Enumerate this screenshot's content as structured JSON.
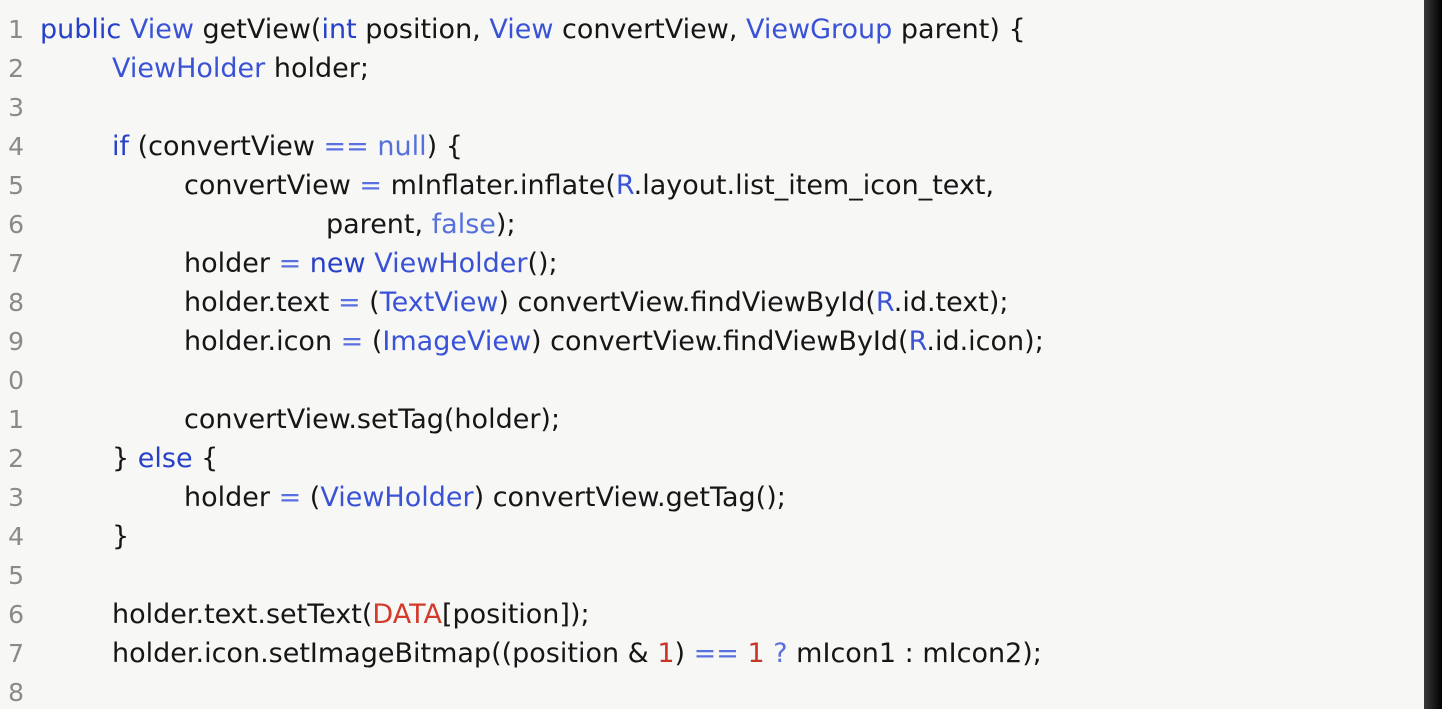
{
  "editor": {
    "lines": [
      {
        "n": "1",
        "indent": 0,
        "tokens": [
          [
            "kw",
            "public"
          ],
          [
            "plain",
            " "
          ],
          [
            "ty",
            "View"
          ],
          [
            "plain",
            " getView("
          ],
          [
            "kw",
            "int"
          ],
          [
            "plain",
            " position, "
          ],
          [
            "ty",
            "View"
          ],
          [
            "plain",
            " convertView, "
          ],
          [
            "ty",
            "ViewGroup"
          ],
          [
            "plain",
            " parent) {"
          ]
        ]
      },
      {
        "n": "2",
        "indent": 1,
        "tokens": [
          [
            "ty",
            "ViewHolder"
          ],
          [
            "plain",
            " holder;"
          ]
        ]
      },
      {
        "n": "3",
        "indent": 0,
        "tokens": []
      },
      {
        "n": "4",
        "indent": 1,
        "tokens": [
          [
            "kw",
            "if"
          ],
          [
            "plain",
            " (convertView "
          ],
          [
            "op",
            "=="
          ],
          [
            "plain",
            " "
          ],
          [
            "lit",
            "null"
          ],
          [
            "plain",
            ") {"
          ]
        ]
      },
      {
        "n": "5",
        "indent": 2,
        "tokens": [
          [
            "plain",
            "convertView "
          ],
          [
            "op",
            "="
          ],
          [
            "plain",
            " mInflater.inflate("
          ],
          [
            "ty",
            "R"
          ],
          [
            "plain",
            ".layout.list_item_icon_text,"
          ]
        ]
      },
      {
        "n": "6",
        "indent": 4,
        "tokens": [
          [
            "plain",
            "parent, "
          ],
          [
            "lit",
            "false"
          ],
          [
            "plain",
            ");"
          ]
        ]
      },
      {
        "n": "7",
        "indent": 2,
        "tokens": [
          [
            "plain",
            "holder "
          ],
          [
            "op",
            "="
          ],
          [
            "plain",
            " "
          ],
          [
            "kw",
            "new"
          ],
          [
            "plain",
            " "
          ],
          [
            "ty",
            "ViewHolder"
          ],
          [
            "plain",
            "();"
          ]
        ]
      },
      {
        "n": "8",
        "indent": 2,
        "tokens": [
          [
            "plain",
            "holder.text "
          ],
          [
            "op",
            "="
          ],
          [
            "plain",
            " ("
          ],
          [
            "ty",
            "TextView"
          ],
          [
            "plain",
            ") convertView.findViewById("
          ],
          [
            "ty",
            "R"
          ],
          [
            "plain",
            ".id.text);"
          ]
        ]
      },
      {
        "n": "9",
        "indent": 2,
        "tokens": [
          [
            "plain",
            "holder.icon "
          ],
          [
            "op",
            "="
          ],
          [
            "plain",
            " ("
          ],
          [
            "ty",
            "ImageView"
          ],
          [
            "plain",
            ") convertView.findViewById("
          ],
          [
            "ty",
            "R"
          ],
          [
            "plain",
            ".id.icon);"
          ]
        ]
      },
      {
        "n": "0",
        "indent": 0,
        "tokens": []
      },
      {
        "n": "1",
        "indent": 2,
        "tokens": [
          [
            "plain",
            "convertView.setTag(holder);"
          ]
        ]
      },
      {
        "n": "2",
        "indent": 1,
        "tokens": [
          [
            "plain",
            "} "
          ],
          [
            "kw",
            "else"
          ],
          [
            "plain",
            " {"
          ]
        ]
      },
      {
        "n": "3",
        "indent": 2,
        "tokens": [
          [
            "plain",
            "holder "
          ],
          [
            "op",
            "="
          ],
          [
            "plain",
            " ("
          ],
          [
            "ty",
            "ViewHolder"
          ],
          [
            "plain",
            ") convertView.getTag();"
          ]
        ]
      },
      {
        "n": "4",
        "indent": 1,
        "tokens": [
          [
            "plain",
            "}"
          ]
        ]
      },
      {
        "n": "5",
        "indent": 0,
        "tokens": []
      },
      {
        "n": "6",
        "indent": 1,
        "tokens": [
          [
            "plain",
            "holder.text.setText("
          ],
          [
            "red",
            "DATA"
          ],
          [
            "plain",
            "[position]);"
          ]
        ]
      },
      {
        "n": "7",
        "indent": 1,
        "tokens": [
          [
            "plain",
            "holder.icon.setImageBitmap((position & "
          ],
          [
            "num",
            "1"
          ],
          [
            "plain",
            ") "
          ],
          [
            "op",
            "=="
          ],
          [
            "plain",
            " "
          ],
          [
            "num",
            "1"
          ],
          [
            "plain",
            " "
          ],
          [
            "op",
            "?"
          ],
          [
            "plain",
            " mIcon1 : mIcon2);"
          ]
        ]
      },
      {
        "n": "8",
        "indent": 0,
        "tokens": []
      }
    ]
  },
  "colors": {
    "background": "#f7f7f5",
    "text": "#161616",
    "keyword": "#2640c8",
    "type": "#3a53d6",
    "operator": "#5a70e0",
    "literal": "#5670dc",
    "constant": "#d23a2a",
    "number": "#c8362a",
    "line_number": "#8a8a8a"
  }
}
